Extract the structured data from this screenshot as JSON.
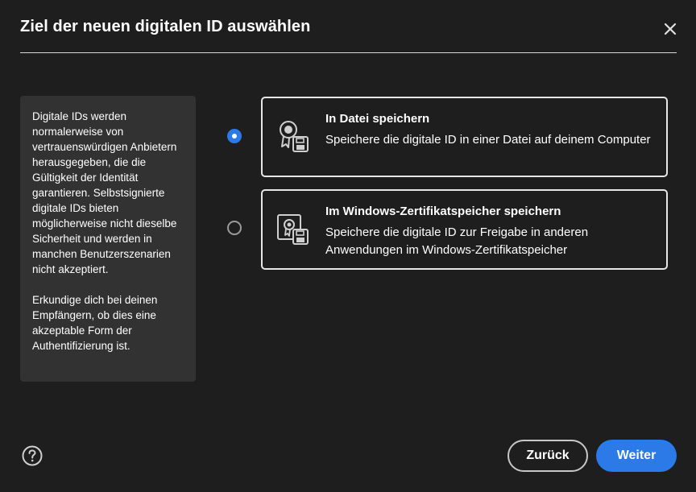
{
  "dialog": {
    "title": "Ziel der neuen digitalen ID auswählen"
  },
  "info": {
    "paragraph1": "Digitale IDs werden normalerweise von vertrauenswürdigen Anbietern herausgegeben, die die Gültigkeit der Identität garantieren. Selbstsignierte digitale IDs bieten möglicherweise nicht dieselbe Sicherheit und werden in manchen Benutzerszenarien nicht akzeptiert.",
    "paragraph2": "Erkundige dich bei deinen Empfängern, ob dies eine akzeptable Form der Authentifizierung ist."
  },
  "options": [
    {
      "title": "In Datei speichern",
      "description": "Speichere die digitale ID in einer Datei auf deinem Computer",
      "selected": true,
      "icon": "certificate-save-icon"
    },
    {
      "title": "Im Windows-Zertifikatspeicher speichern",
      "description": "Speichere die digitale ID zur Freigabe in anderen Anwendungen im Windows-Zertifikatspeicher",
      "selected": false,
      "icon": "certificate-store-icon"
    }
  ],
  "footer": {
    "help_icon": "help-icon",
    "back_label": "Zurück",
    "next_label": "Weiter"
  },
  "colors": {
    "background": "#1e1e1e",
    "panel": "#323232",
    "accent": "#2c7ae8",
    "border": "#e6e6e6"
  }
}
